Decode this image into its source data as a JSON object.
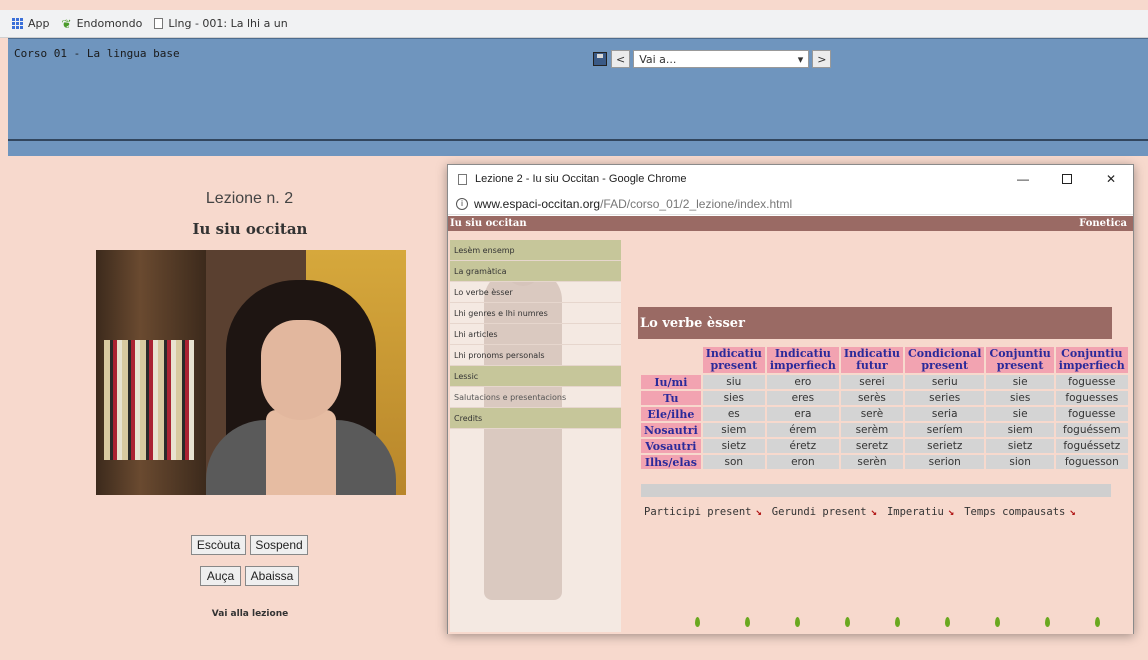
{
  "bookmarks": [
    {
      "label": "App",
      "icon": "apps-grid-icon"
    },
    {
      "label": "Endomondo",
      "icon": "leaf-icon"
    },
    {
      "label": "Llng - 001: La lhi a un",
      "icon": "page-icon"
    }
  ],
  "topframe": {
    "course_title": "Corso 01 - La lingua base",
    "prev_label": "<",
    "next_label": ">",
    "goto_placeholder": "Vai a...",
    "goto_arrow": "▾"
  },
  "lesson": {
    "number": "Lezione n. 2",
    "title": "Iu siu occitan",
    "listen_label": "Escòuta",
    "suspend_label": "Sospend",
    "raise_label": "Auça",
    "lower_label": "Abaissa",
    "go_to_lesson": "Vai alla lezione"
  },
  "popup": {
    "window_title": "Lezione 2 - Iu siu Occitan - Google Chrome",
    "url_host": "www.espaci-occitan.org",
    "url_path": "/FAD/corso_01/2_lezione/index.html",
    "page_left": "Iu siu occitan",
    "page_right": "Fonetica",
    "menu": [
      {
        "label": "Lesèm ensemp",
        "type": "sec"
      },
      {
        "label": "La gramàtica",
        "type": "sec"
      },
      {
        "label": "Lo verbe èsser",
        "type": "item"
      },
      {
        "label": "Lhi genres e lhi numres",
        "type": "item"
      },
      {
        "label": "Lhi articles",
        "type": "item"
      },
      {
        "label": "Lhi pronoms personals",
        "type": "item"
      },
      {
        "label": "Lessic",
        "type": "sec"
      },
      {
        "label": "Salutacions e presentacions",
        "type": "sel"
      },
      {
        "label": "Credits",
        "type": "sec"
      }
    ],
    "section_title": "Lo verbe èsser",
    "table": {
      "headers": [
        [
          "Indicatiu",
          "present"
        ],
        [
          "Indicatiu",
          "imperfiech"
        ],
        [
          "Indicatiu",
          "futur"
        ],
        [
          "Condicional",
          "present"
        ],
        [
          "Conjuntiu",
          "present"
        ],
        [
          "Conjuntiu",
          "imperfiech"
        ]
      ],
      "rows": [
        {
          "pron": "Iu/mi",
          "cells": [
            "siu",
            "ero",
            "serei",
            "seriu",
            "sie",
            "foguesse"
          ]
        },
        {
          "pron": "Tu",
          "cells": [
            "sies",
            "eres",
            "serès",
            "series",
            "sies",
            "foguesses"
          ]
        },
        {
          "pron": "Ele/ilhe",
          "cells": [
            "es",
            "era",
            "serè",
            "seria",
            "sie",
            "foguesse"
          ]
        },
        {
          "pron": "Nosautri",
          "cells": [
            "siem",
            "érem",
            "serèm",
            "seríem",
            "siem",
            "foguéssem"
          ]
        },
        {
          "pron": "Vosautri",
          "cells": [
            "sietz",
            "éretz",
            "seretz",
            "serietz",
            "sietz",
            "foguéssetz"
          ]
        },
        {
          "pron": "Ilhs/elas",
          "cells": [
            "son",
            "eron",
            "serèn",
            "serion",
            "sion",
            "foguesson"
          ]
        }
      ]
    },
    "links": [
      "Participi present",
      "Gerundi present",
      "Imperatiu",
      "Temps compausats"
    ]
  },
  "colors": {
    "page_bg": "#f7d9cd",
    "topframe_bg": "#6f95be",
    "title_bar": "#9a6a64",
    "table_header": "#f2a3b1",
    "header_text": "#2a2a9a",
    "cell_bg": "#d4d4d4",
    "menu_section": "#c6c69a"
  }
}
